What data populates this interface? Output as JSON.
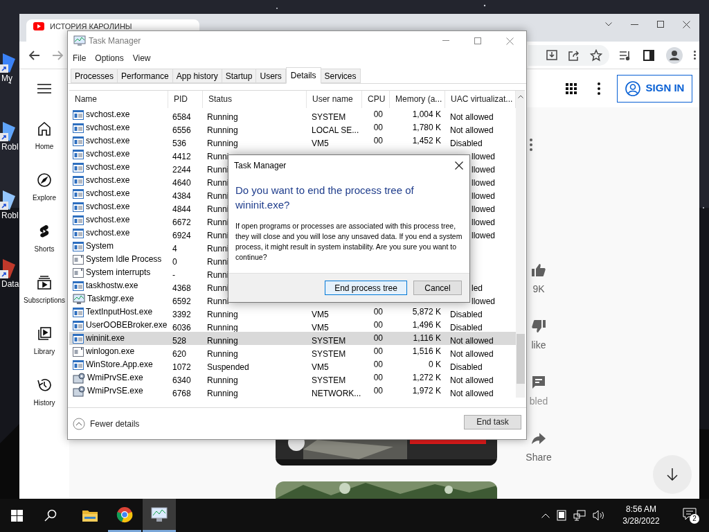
{
  "desktop_icons": [
    {
      "label": "My"
    },
    {
      "label": "Robl"
    },
    {
      "label": "Robl"
    },
    {
      "label": "Data"
    }
  ],
  "browser": {
    "tab_title": "ИСТОРИЯ КАРОЛИНЫ",
    "sign_in": "SIGN IN",
    "sidebar": [
      {
        "kind": "home",
        "label": "Home"
      },
      {
        "kind": "explore",
        "label": "Explore"
      },
      {
        "kind": "shorts",
        "label": "Shorts"
      },
      {
        "kind": "subscriptions",
        "label": "Subscriptions"
      },
      {
        "kind": "library",
        "label": "Library"
      },
      {
        "kind": "history",
        "label": "History"
      }
    ],
    "actions": [
      {
        "kind": "like",
        "label": "9K"
      },
      {
        "kind": "dislike",
        "label": "like"
      },
      {
        "kind": "comments",
        "label": "bled"
      },
      {
        "kind": "share",
        "label": "Share"
      }
    ]
  },
  "task_manager": {
    "title": "Task Manager",
    "menu": [
      "File",
      "Options",
      "View"
    ],
    "tabs": [
      {
        "label": "Processes",
        "selected": false
      },
      {
        "label": "Performance",
        "selected": false
      },
      {
        "label": "App history",
        "selected": false
      },
      {
        "label": "Startup",
        "selected": false
      },
      {
        "label": "Users",
        "selected": false
      },
      {
        "label": "Details",
        "selected": true
      },
      {
        "label": "Services",
        "selected": false
      }
    ],
    "columns": [
      "Name",
      "PID",
      "Status",
      "User name",
      "CPU",
      "Memory (a...",
      "UAC virtualizat..."
    ],
    "rows": [
      {
        "kind": "window",
        "name": "svchost.exe",
        "pid": "6584",
        "status": "Running",
        "user": "SYSTEM",
        "cpu": "00",
        "memory": "1,004 K",
        "uac": "Not allowed",
        "selected": false
      },
      {
        "kind": "window",
        "name": "svchost.exe",
        "pid": "6556",
        "status": "Running",
        "user": "LOCAL SE...",
        "cpu": "00",
        "memory": "1,780 K",
        "uac": "Not allowed",
        "selected": false
      },
      {
        "kind": "window",
        "name": "svchost.exe",
        "pid": "536",
        "status": "Running",
        "user": "VM5",
        "cpu": "00",
        "memory": "1,452 K",
        "uac": "Disabled",
        "selected": false
      },
      {
        "kind": "window",
        "name": "svchost.exe",
        "pid": "4412",
        "status": "Runni",
        "uac": "llowed",
        "selected": false
      },
      {
        "kind": "window",
        "name": "svchost.exe",
        "pid": "2244",
        "status": "Runni",
        "uac": "llowed",
        "selected": false
      },
      {
        "kind": "window",
        "name": "svchost.exe",
        "pid": "4640",
        "status": "Runni",
        "uac": "llowed",
        "selected": false
      },
      {
        "kind": "window",
        "name": "svchost.exe",
        "pid": "4384",
        "status": "Runni",
        "uac": "llowed",
        "selected": false
      },
      {
        "kind": "window",
        "name": "svchost.exe",
        "pid": "4844",
        "status": "Runni",
        "uac": "llowed",
        "selected": false
      },
      {
        "kind": "window",
        "name": "svchost.exe",
        "pid": "6672",
        "status": "Runni",
        "uac": "llowed",
        "selected": false
      },
      {
        "kind": "window",
        "name": "svchost.exe",
        "pid": "6924",
        "status": "Runni",
        "uac": "llowed",
        "selected": false
      },
      {
        "kind": "window",
        "name": "System",
        "pid": "4",
        "status": "Runni",
        "selected": false
      },
      {
        "kind": "blank",
        "name": "System Idle Process",
        "pid": "0",
        "status": "Runni",
        "selected": false
      },
      {
        "kind": "blank",
        "name": "System interrupts",
        "pid": "-",
        "status": "Runni",
        "selected": false
      },
      {
        "kind": "window",
        "name": "taskhostw.exe",
        "pid": "4368",
        "status": "Runni",
        "uac": "led",
        "selected": false
      },
      {
        "kind": "chart",
        "name": "Taskmgr.exe",
        "pid": "6592",
        "status": "Runni",
        "uac": "llowed",
        "selected": false
      },
      {
        "kind": "window",
        "name": "TextInputHost.exe",
        "pid": "3392",
        "status": "Running",
        "user": "VM5",
        "cpu": "00",
        "memory": "5,872 K",
        "uac": "Disabled",
        "selected": false
      },
      {
        "kind": "window",
        "name": "UserOOBEBroker.exe",
        "pid": "6036",
        "status": "Running",
        "user": "VM5",
        "cpu": "00",
        "memory": "1,496 K",
        "uac": "Disabled",
        "selected": false
      },
      {
        "kind": "window",
        "name": "wininit.exe",
        "pid": "528",
        "status": "Running",
        "user": "SYSTEM",
        "cpu": "00",
        "memory": "1,116 K",
        "uac": "Not allowed",
        "selected": true
      },
      {
        "kind": "blank",
        "name": "winlogon.exe",
        "pid": "620",
        "status": "Running",
        "user": "SYSTEM",
        "cpu": "00",
        "memory": "1,516 K",
        "uac": "Not allowed",
        "selected": false
      },
      {
        "kind": "window",
        "name": "WinStore.App.exe",
        "pid": "1072",
        "status": "Suspended",
        "user": "VM5",
        "cpu": "00",
        "memory": "0 K",
        "uac": "Disabled",
        "selected": false
      },
      {
        "kind": "gear",
        "name": "WmiPrvSE.exe",
        "pid": "6340",
        "status": "Running",
        "user": "SYSTEM",
        "cpu": "00",
        "memory": "1,272 K",
        "uac": "Not allowed",
        "selected": false
      },
      {
        "kind": "gear",
        "name": "WmiPrvSE.exe",
        "pid": "6768",
        "status": "Running",
        "user": "NETWORK...",
        "cpu": "00",
        "memory": "1,972 K",
        "uac": "Not allowed",
        "selected": false
      }
    ],
    "fewer_details": "Fewer details",
    "end_task": "End task"
  },
  "dialog": {
    "title": "Task Manager",
    "heading": "Do you want to end the process tree of wininit.exe?",
    "message": "If open programs or processes are associated with this process tree, they will close and you will lose any unsaved data. If you end a system process, it might result in system instability. Are you sure you want to continue?",
    "buttons": [
      {
        "label": "End process tree",
        "default": true
      },
      {
        "label": "Cancel",
        "default": false
      }
    ]
  },
  "taskbar": {
    "time": "8:56 AM",
    "date": "3/28/2022",
    "notifications": "2"
  }
}
